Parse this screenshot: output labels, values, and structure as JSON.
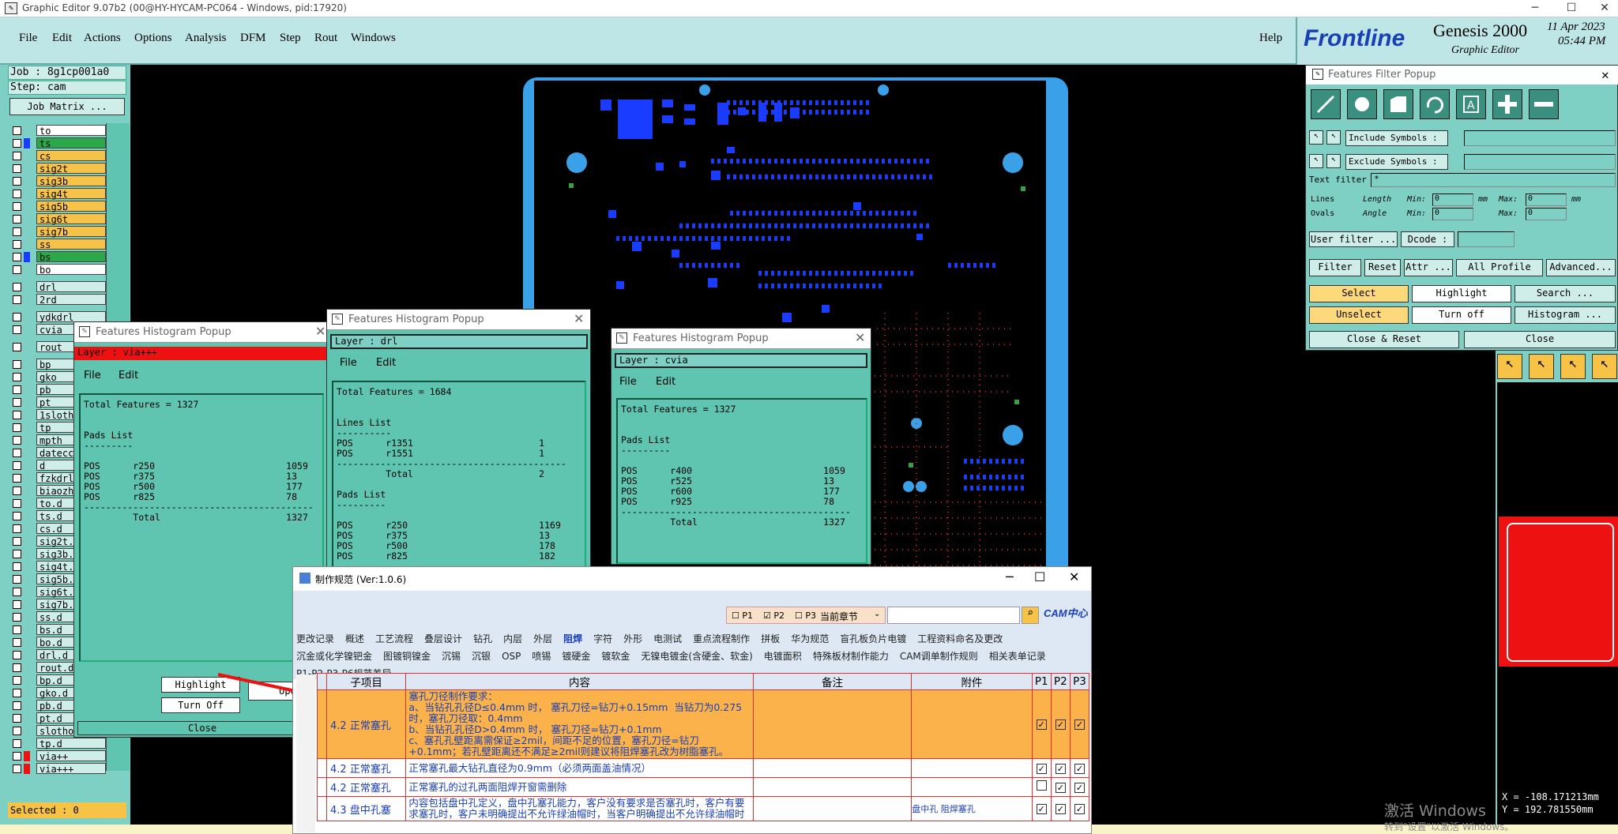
{
  "window": {
    "title": "Graphic Editor 9.07b2 (00@HY-HYCAM-PC064 - Windows, pid:17920)"
  },
  "menu": [
    "File",
    "Edit",
    "Actions",
    "Options",
    "Analysis",
    "DFM",
    "Step",
    "Rout",
    "Windows"
  ],
  "help_label": "Help",
  "brand": {
    "logo": "Frontline",
    "product": "Genesis 2000",
    "subtitle": "Graphic Editor",
    "date": "11 Apr 2023",
    "time": "05:44 PM"
  },
  "job": {
    "job_line": "Job : 8g1cp001a0",
    "step_line": "Step: cam",
    "matrix_button": "Job Matrix ..."
  },
  "layers": [
    {
      "name": "to",
      "color": "#ffffff"
    },
    {
      "name": "ts",
      "color": "#2aa84a"
    },
    {
      "name": "cs",
      "color": "#f6c347"
    },
    {
      "name": "sig2t",
      "color": "#f6c347"
    },
    {
      "name": "sig3b",
      "color": "#f6c347"
    },
    {
      "name": "sig4t",
      "color": "#f6c347"
    },
    {
      "name": "sig5b",
      "color": "#f6c347"
    },
    {
      "name": "sig6t",
      "color": "#f6c347"
    },
    {
      "name": "sig7b",
      "color": "#f6c347"
    },
    {
      "name": "ss",
      "color": "#f6c347"
    },
    {
      "name": "bs",
      "color": "#2aa84a"
    },
    {
      "name": "bo",
      "color": "#ffffff"
    },
    {
      "name": "drl",
      "color": "#cfeeea"
    },
    {
      "name": "2rd",
      "color": "#cfeeea"
    },
    {
      "name": "ydkdrl",
      "color": "#cfeeea"
    },
    {
      "name": "cvia",
      "color": "#cfeeea"
    },
    {
      "name": "rout",
      "color": "#cfeeea"
    },
    {
      "name": "bp",
      "color": "#cfeeea"
    },
    {
      "name": "gko",
      "color": "#cfeeea"
    },
    {
      "name": "pb",
      "color": "#cfeeea"
    },
    {
      "name": "pt",
      "color": "#cfeeea"
    },
    {
      "name": "1sloth",
      "color": "#cfeeea"
    },
    {
      "name": "tp",
      "color": "#cfeeea"
    },
    {
      "name": "mpth",
      "color": "#cfeeea"
    },
    {
      "name": "datecc",
      "color": "#cfeeea"
    },
    {
      "name": "d",
      "color": "#cfeeea"
    },
    {
      "name": "fzkdrl",
      "color": "#cfeeea"
    },
    {
      "name": "biaozh",
      "color": "#cfeeea"
    },
    {
      "name": "to.d",
      "color": "#cfeeea"
    },
    {
      "name": "ts.d",
      "color": "#cfeeea"
    },
    {
      "name": "cs.d",
      "color": "#cfeeea"
    },
    {
      "name": "sig2t.",
      "color": "#cfeeea"
    },
    {
      "name": "sig3b.",
      "color": "#cfeeea"
    },
    {
      "name": "sig4t.",
      "color": "#cfeeea"
    },
    {
      "name": "sig5b.",
      "color": "#cfeeea"
    },
    {
      "name": "sig6t.",
      "color": "#cfeeea"
    },
    {
      "name": "sig7b.",
      "color": "#cfeeea"
    },
    {
      "name": "ss.d",
      "color": "#cfeeea"
    },
    {
      "name": "bs.d",
      "color": "#cfeeea"
    },
    {
      "name": "bo.d",
      "color": "#cfeeea"
    },
    {
      "name": "drl.d",
      "color": "#cfeeea"
    },
    {
      "name": "rout.d",
      "color": "#cfeeea"
    },
    {
      "name": "bp.d",
      "color": "#cfeeea"
    },
    {
      "name": "gko.d",
      "color": "#cfeeea"
    },
    {
      "name": "pb.d",
      "color": "#cfeeea"
    },
    {
      "name": "pt.d",
      "color": "#cfeeea"
    },
    {
      "name": "slotho",
      "color": "#cfeeea"
    },
    {
      "name": "tp.d",
      "color": "#cfeeea"
    },
    {
      "name": "via++",
      "color": "#cfeeea"
    },
    {
      "name": "via+++",
      "color": "#cfeeea"
    }
  ],
  "selected_label": "Selected : 0",
  "hist1": {
    "title": "Features Histogram Popup",
    "layer": "Layer :  via+++",
    "menu": [
      "File",
      "Edit"
    ],
    "total": "Total Features = 1327",
    "section": "Pads List",
    "rows": [
      [
        "POS",
        "r250",
        "1059"
      ],
      [
        "POS",
        "r375",
        "13"
      ],
      [
        "POS",
        "r500",
        "177"
      ],
      [
        "POS",
        "r825",
        "78"
      ]
    ],
    "total_row": [
      "Total",
      "1327"
    ],
    "highlight": "Highlight",
    "turnoff": "Turn Off",
    "upd": "Upd",
    "close": "Close"
  },
  "hist2": {
    "title": "Features Histogram Popup",
    "layer": "Layer :  drl",
    "menu": [
      "File",
      "Edit"
    ],
    "total": "Total Features = 1684",
    "lines_section": "Lines List",
    "lines_rows": [
      [
        "POS",
        "r1351",
        "1"
      ],
      [
        "POS",
        "r1551",
        "1"
      ]
    ],
    "lines_total": [
      "Total",
      "2"
    ],
    "pads_section": "Pads List",
    "pads_rows": [
      [
        "POS",
        "r250",
        "1169"
      ],
      [
        "POS",
        "r375",
        "13"
      ],
      [
        "POS",
        "r500",
        "178"
      ],
      [
        "POS",
        "r825",
        "182"
      ]
    ]
  },
  "hist3": {
    "title": "Features Histogram Popup",
    "layer": "Layer :  cvia",
    "menu": [
      "File",
      "Edit"
    ],
    "total": "Total Features = 1327",
    "section": "Pads List",
    "rows": [
      [
        "POS",
        "r400",
        "1059"
      ],
      [
        "POS",
        "r525",
        "13"
      ],
      [
        "POS",
        "r600",
        "177"
      ],
      [
        "POS",
        "r925",
        "78"
      ]
    ],
    "total_row": [
      "Total",
      "1327"
    ]
  },
  "filter": {
    "title": "Features Filter Popup",
    "include": "Include Symbols :",
    "exclude": "Exclude Symbols :",
    "text_filter": "Text filter",
    "text_filter_value": "*",
    "lines": "Lines",
    "ovals": "Ovals",
    "length": "Length",
    "angle": "Angle",
    "min": "Min:",
    "max": "Max:",
    "zero": "0",
    "mm": "mm",
    "user_filter": "User filter ...",
    "dcode": "Dcode :",
    "filter": "Filter",
    "reset": "Reset",
    "attr": "Attr ...",
    "all_profile": "All Profile",
    "advanced": "Advanced...",
    "select": "Select",
    "highlight": "Highlight",
    "search": "Search ...",
    "unselect": "Unselect",
    "turnoff": "Turn off",
    "histogram": "Histogram ...",
    "close_reset": "Close & Reset",
    "close": "Close"
  },
  "coords": {
    "x": "X =  -108.171213mm",
    "y": "Y =  192.781550mm"
  },
  "watermark": {
    "line1": "激活 Windows",
    "line2": "转到\"设置\"以激活 Windows。"
  },
  "dialog": {
    "title": "制作规范 (Ver:1.0.6)",
    "p1": "P1",
    "p2": "P2",
    "p3": "P3",
    "chapter": "当前章节",
    "cam_logo": "CAM中心",
    "tabs1": [
      "更改记录",
      "概述",
      "工艺流程",
      "叠层设计",
      "钻孔",
      "内层",
      "外层",
      "阻焊",
      "字符",
      "外形",
      "电测试",
      "重点流程制作",
      "拼板",
      "华为规范",
      "盲孔板负片电镀",
      "工程资料命名及更改"
    ],
    "tabs2": [
      "沉金或化学镍钯金",
      "图镀铜镍金",
      "沉锡",
      "沉银",
      "OSP",
      "喷锡",
      "镀硬金",
      "镀软金",
      "无镍电镀金(含硬金、软金)",
      "电镀面积",
      "特殊板材制作能力",
      "CAM调单制作规则",
      "相关表单记录"
    ],
    "tabs3": [
      "P1-P2-P3-P6规范差异"
    ],
    "active_tab": "阻焊",
    "headers": [
      "子项目",
      "内容",
      "备注",
      "附件",
      "P1",
      "P2",
      "P3"
    ],
    "rows": [
      {
        "sub": "4.2 正常塞孔",
        "content": "塞孔刀径制作要求：\na、当钻孔孔径D≤0.4mm 时， 塞孔刀径=钻刀+0.15mm  当钻刀为0.275时，塞孔刀径取：0.4mm\nb、当钻孔孔径D>0.4mm 时， 塞孔刀径=钻刀+0.1mm\nc、塞孔孔壁距离需保证≥2mil，间距不足的位置，塞孔刀径=钻刀+0.1mm；若孔壁距离还不满足≥2mil则建议将阻焊塞孔改为树脂塞孔。",
        "note": "",
        "att": "",
        "p": [
          true,
          true,
          true
        ],
        "hl": true
      },
      {
        "sub": "4.2 正常塞孔",
        "content": "正常塞孔最大钻孔直径为0.9mm（必须两面盖油情况）",
        "note": "",
        "att": "",
        "p": [
          true,
          true,
          true
        ],
        "hl": false
      },
      {
        "sub": "4.2 正常塞孔",
        "content": "正常塞孔的过孔两面阻焊开窗需删除",
        "note": "",
        "att": "",
        "p": [
          false,
          true,
          true
        ],
        "hl": false
      },
      {
        "sub": "4.3 盘中孔塞",
        "content": "内容包括盘中孔定义，盘中孔塞孔能力，客户没有要求是否塞孔时，客户有要求塞孔时，客户未明确提出不允许绿油帽时，当客户明确提出不允许绿油帽时",
        "note": "",
        "att": "盘中孔 阻焊塞孔",
        "p": [
          true,
          true,
          true
        ],
        "hl": false
      }
    ]
  }
}
